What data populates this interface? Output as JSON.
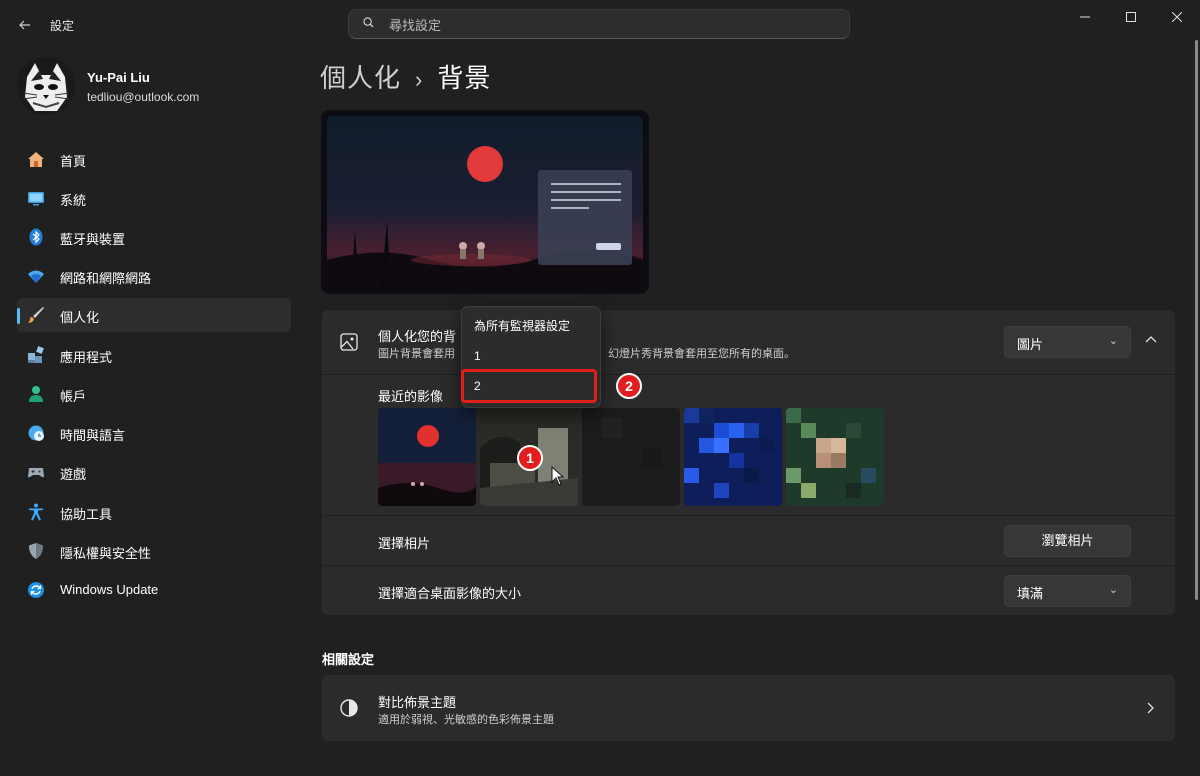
{
  "window": {
    "title": "設定",
    "back_icon": "arrow-left-icon",
    "controls": [
      "minimize-icon",
      "maximize-icon",
      "close-icon"
    ]
  },
  "search": {
    "placeholder": "尋找設定",
    "value": ""
  },
  "user": {
    "name": "Yu-Pai Liu",
    "email": "tedliou@outlook.com"
  },
  "sidebar": {
    "items": [
      {
        "label": "首頁",
        "icon": "home-icon"
      },
      {
        "label": "系統",
        "icon": "system-display-icon"
      },
      {
        "label": "藍牙與裝置",
        "icon": "bluetooth-icon"
      },
      {
        "label": "網路和網際網路",
        "icon": "wifi-icon"
      },
      {
        "label": "個人化",
        "icon": "brush-icon",
        "active": true
      },
      {
        "label": "應用程式",
        "icon": "apps-icon"
      },
      {
        "label": "帳戶",
        "icon": "account-icon"
      },
      {
        "label": "時間與語言",
        "icon": "time-language-icon"
      },
      {
        "label": "遊戲",
        "icon": "gamepad-icon"
      },
      {
        "label": "協助工具",
        "icon": "accessibility-icon"
      },
      {
        "label": "隱私權與安全性",
        "icon": "shield-icon"
      },
      {
        "label": "Windows Update",
        "icon": "windows-update-icon"
      }
    ]
  },
  "breadcrumb": {
    "parent": "個人化",
    "separator": "›",
    "current": "背景"
  },
  "background_card": {
    "title": "個人化您的背",
    "description_left": "圖片背景會套用",
    "description_right": "幻燈片秀背景會套用至您所有的桌面。",
    "type_value": "圖片",
    "recent_label": "最近的影像",
    "choose_photo_label": "選擇相片",
    "browse_button": "瀏覽相片",
    "fit_label": "選擇適合桌面影像的大小",
    "fit_value": "填滿"
  },
  "context_menu": {
    "items": [
      "為所有監視器設定",
      "1",
      "2"
    ],
    "highlighted": "2"
  },
  "callouts": [
    "1",
    "2"
  ],
  "related": {
    "heading": "相關設定",
    "item_title": "對比佈景主題",
    "item_desc": "適用於弱視、光敏感的色彩佈景主題",
    "icon": "contrast-icon"
  },
  "colors": {
    "accent": "#4cc2ff",
    "callout_red": "#e11d1d",
    "background": "#202020",
    "card": "#2b2b2b"
  }
}
